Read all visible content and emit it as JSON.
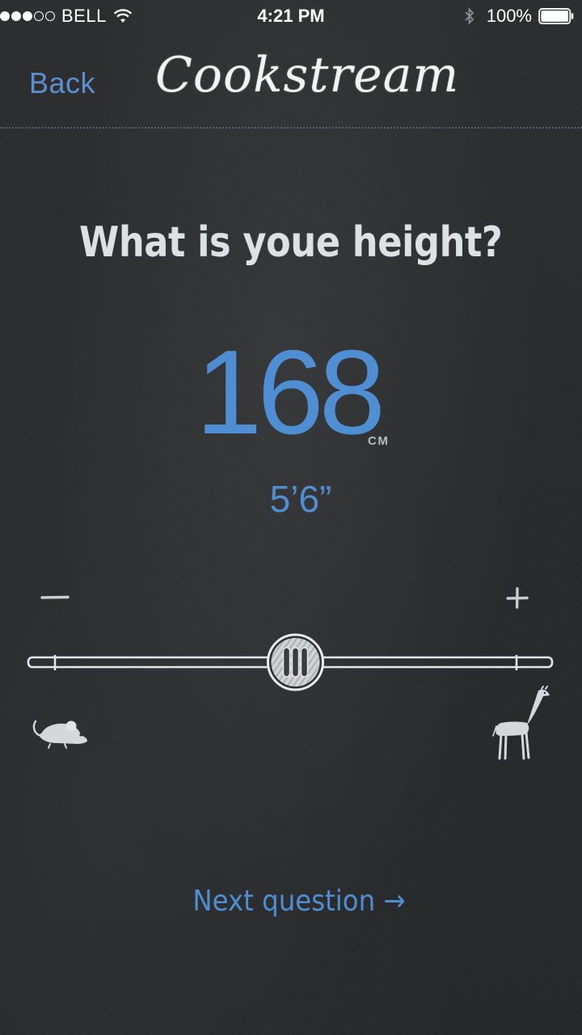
{
  "status_bar": {
    "carrier": "BELL",
    "signal_bars_filled": 3,
    "signal_bars_total": 5,
    "time": "4:21 PM",
    "battery_percent": "100%"
  },
  "nav": {
    "back_label": "Back",
    "title": "Cookstream"
  },
  "question": {
    "text": "What is youe height?"
  },
  "height": {
    "value_cm": "168",
    "unit": "CM",
    "value_imperial": "5’6”"
  },
  "slider": {
    "minus_icon": "minus-icon",
    "plus_icon": "plus-icon",
    "min_icon": "mouse-icon",
    "max_icon": "giraffe-icon",
    "position_fraction": 0.51
  },
  "footer": {
    "next_label": "Next question →"
  },
  "colors": {
    "accent_blue": "#4f8ed3",
    "back_blue": "#5c8fcf",
    "chalkboard": "#2a2c2e",
    "chalk": "#dde1e3"
  }
}
